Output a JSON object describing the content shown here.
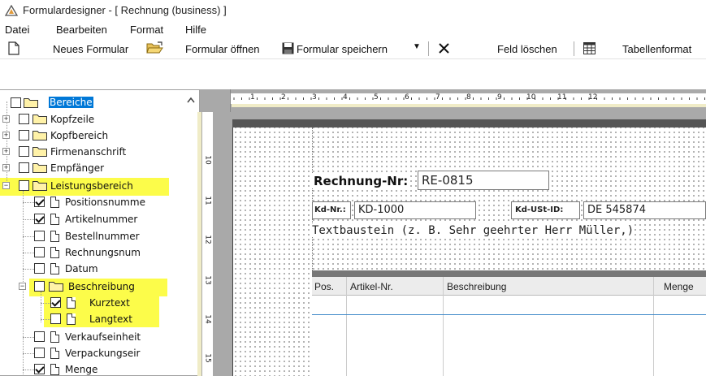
{
  "window": {
    "title": "Formulardesigner - [ Rechnung (business) ]"
  },
  "menu": {
    "items": [
      "Datei",
      "Bearbeiten",
      "Format",
      "Hilfe"
    ]
  },
  "toolbar": {
    "new_label": "Neues Formular",
    "open_label": "Formular öffnen",
    "save_label": "Formular speichern",
    "delete_label": "Feld löschen",
    "table_label": "Tabellenformat"
  },
  "tree": {
    "root": "Bereiche",
    "items": {
      "kopfzeile": "Kopfzeile",
      "kopfbereich": "Kopfbereich",
      "firmenanschrift": "Firmenanschrift",
      "empfaenger": "Empfänger",
      "leistungsbereich": "Leistungsbereich",
      "positionsnummer": "Positionsnumme",
      "artikelnummer": "Artikelnummer",
      "bestellnummer": "Bestellnummer",
      "rechnungsnummer": "Rechnungsnum",
      "datum": "Datum",
      "beschreibung": "Beschreibung",
      "kurztext": "Kurztext",
      "langtext": "Langtext",
      "verkaufseinheit": "Verkaufseinheit",
      "verpackungseinheit": "Verpackungseir",
      "menge": "Menge"
    }
  },
  "ruler": {
    "top_numbers": [
      "1",
      "2",
      "3",
      "4",
      "5",
      "6",
      "7",
      "8",
      "9",
      "10",
      "11",
      "12"
    ],
    "left_numbers": [
      "10",
      "11",
      "12",
      "13",
      "14",
      "15"
    ]
  },
  "form": {
    "rechnung_label": "Rechnung-Nr:",
    "rechnung_value": "RE-0815",
    "kdnr_label": "Kd-Nr.:",
    "kdnr_value": "KD-1000",
    "ustid_label": "Kd-USt-ID:",
    "ustid_value": "DE 545874",
    "textbaustein": "Textbaustein (z. B. Sehr geehrter Herr Müller,)",
    "table_headers": [
      "Pos.",
      "Artikel-Nr.",
      "Beschreibung",
      "Menge"
    ]
  },
  "colors": {
    "highlight": "#fcfc4a",
    "selection": "#0078d7",
    "table_line": "#3f89c9"
  }
}
